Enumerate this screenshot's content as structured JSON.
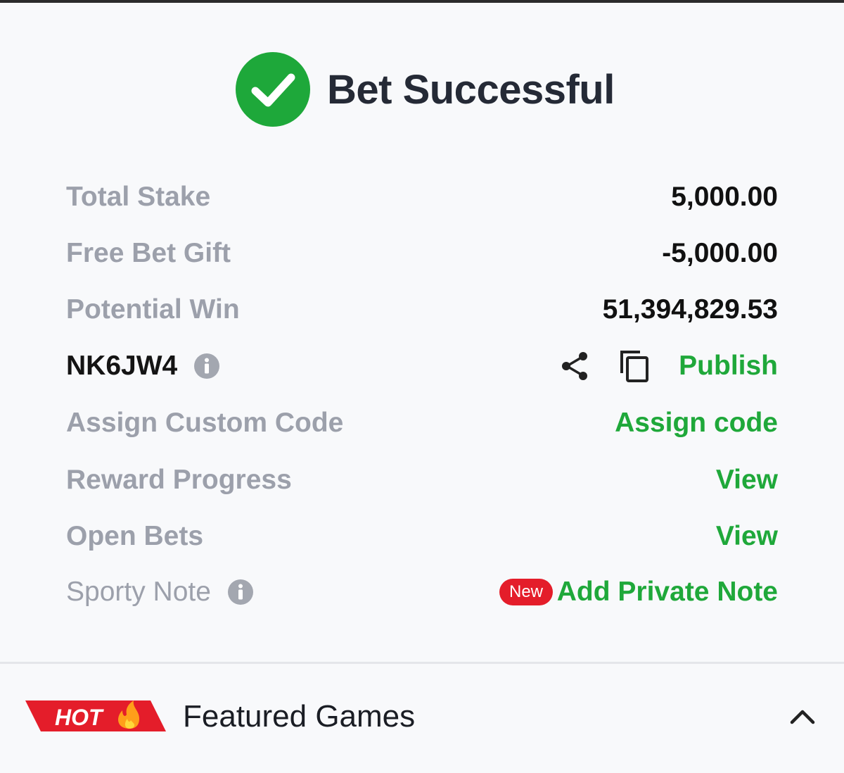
{
  "header": {
    "title": "Bet Successful",
    "icon": "check-circle-icon"
  },
  "summary": {
    "total_stake_label": "Total Stake",
    "total_stake_value": "5,000.00",
    "free_bet_label": "Free Bet Gift",
    "free_bet_value": "-5,000.00",
    "potential_win_label": "Potential Win",
    "potential_win_value": "51,394,829.53"
  },
  "booking": {
    "code": "NK6JW4",
    "publish_label": "Publish",
    "icons": [
      "info-icon",
      "share-icon",
      "copy-icon"
    ]
  },
  "actions": {
    "custom_code_label": "Assign Custom Code",
    "custom_code_action": "Assign code",
    "reward_label": "Reward Progress",
    "reward_action": "View",
    "open_bets_label": "Open Bets",
    "open_bets_action": "View",
    "note_label": "Sporty Note",
    "note_badge": "New",
    "note_action": "Add Private Note"
  },
  "featured": {
    "badge": "HOT",
    "title": "Featured Games"
  },
  "colors": {
    "accent_green": "#1fa83a",
    "badge_red": "#e41d2a",
    "label_gray": "#9ca0ab"
  }
}
